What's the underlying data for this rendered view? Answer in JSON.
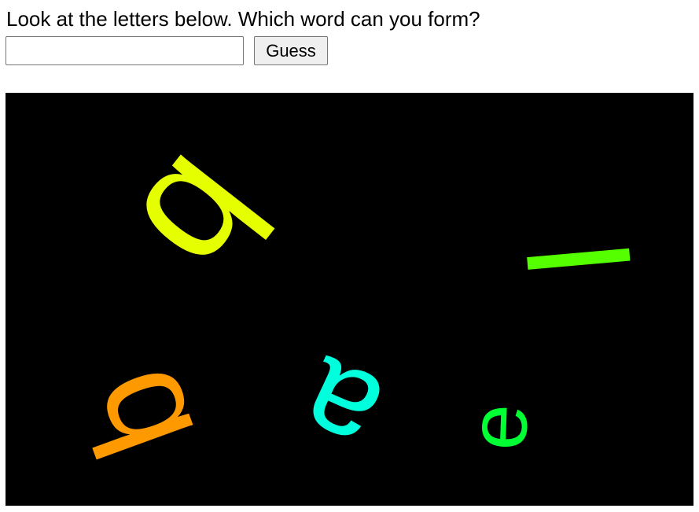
{
  "prompt": "Look at the letters below. Which word can you form?",
  "answer_input": {
    "value": "",
    "placeholder": ""
  },
  "guess_button": "Guess",
  "letters": [
    {
      "char": "b",
      "color": "#e6ff00"
    },
    {
      "char": "l",
      "color": "#55ff00"
    },
    {
      "char": "b",
      "color": "#ff9900"
    },
    {
      "char": "a",
      "color": "#00ffdd"
    },
    {
      "char": "e",
      "color": "#00ff33"
    }
  ]
}
